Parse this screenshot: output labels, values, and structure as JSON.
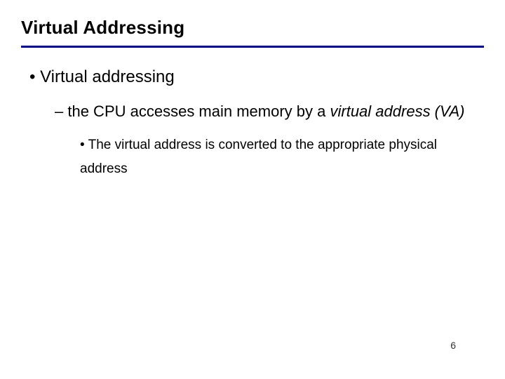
{
  "slide": {
    "title": "Virtual Addressing",
    "bullets": {
      "l1": "Virtual addressing",
      "l2_prefix": "the CPU accesses main memory by a ",
      "l2_ital": "virtual address (VA)",
      "l3": "The virtual address is converted to the appropriate physical address"
    },
    "page_number": "6"
  }
}
